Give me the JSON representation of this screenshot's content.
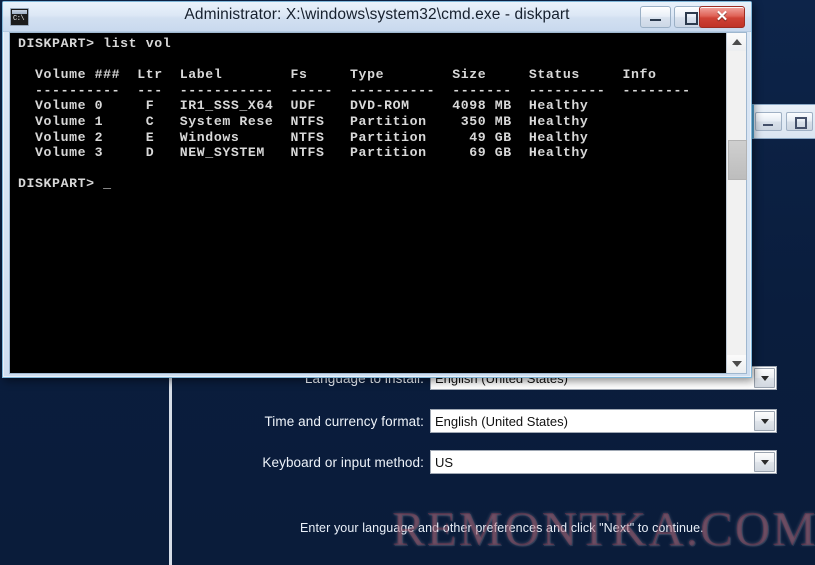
{
  "setup": {
    "rows": [
      {
        "label_pre": "L",
        "label_key": "a",
        "label_post": "nguage to install:",
        "label_full": "Language to install:",
        "value": "English (United States)"
      },
      {
        "label_pre": "",
        "label_key": "T",
        "label_post": "ime and currency format:",
        "label_full": "Time and currency format:",
        "value": "English (United States)"
      },
      {
        "label_pre": "",
        "label_key": "K",
        "label_post": "eyboard or input method:",
        "label_full": "Keyboard or input method:",
        "value": "US"
      }
    ],
    "hint": "Enter your language and other preferences and click \"Next\" to continue.",
    "watermark": "REMONTKA.COM"
  },
  "cmd_window": {
    "title": "Administrator: X:\\windows\\system32\\cmd.exe - diskpart",
    "icon_name": "cmd-console-icon",
    "icon_glyph": "C:\\",
    "buttons": {
      "minimize": "Minimize",
      "maximize": "Maximize",
      "close": "✕"
    },
    "console_text": "DISKPART> list vol\n\n  Volume ###  Ltr  Label        Fs     Type        Size     Status     Info\n  ----------  ---  -----------  -----  ----------  -------  ---------  --------\n  Volume 0     F   IR1_SSS_X64  UDF    DVD-ROM     4098 MB  Healthy\n  Volume 1     C   System Rese  NTFS   Partition    350 MB  Healthy\n  Volume 2     E   Windows      NTFS   Partition     49 GB  Healthy\n  Volume 3     D   NEW_SYSTEM   NTFS   Partition     69 GB  Healthy\n\nDISKPART> _",
    "console_rows": [
      {
        "volume": "Volume 0",
        "ltr": "F",
        "label": "IR1_SSS_X64",
        "fs": "UDF",
        "type": "DVD-ROM",
        "size": "4098 MB",
        "status": "Healthy",
        "info": ""
      },
      {
        "volume": "Volume 1",
        "ltr": "C",
        "label": "System Rese",
        "fs": "NTFS",
        "type": "Partition",
        "size": "350 MB",
        "status": "Healthy",
        "info": ""
      },
      {
        "volume": "Volume 2",
        "ltr": "E",
        "label": "Windows",
        "fs": "NTFS",
        "type": "Partition",
        "size": "49 GB",
        "status": "Healthy",
        "info": ""
      },
      {
        "volume": "Volume 3",
        "ltr": "D",
        "label": "NEW_SYSTEM",
        "fs": "NTFS",
        "type": "Partition",
        "size": "69 GB",
        "status": "Healthy",
        "info": ""
      }
    ],
    "console_headers": [
      "Volume ###",
      "Ltr",
      "Label",
      "Fs",
      "Type",
      "Size",
      "Status",
      "Info"
    ],
    "command": "list vol",
    "prompt": "DISKPART>"
  },
  "background_window": {
    "minimize_label": "Minimize",
    "maximize_label": "Maximize"
  }
}
